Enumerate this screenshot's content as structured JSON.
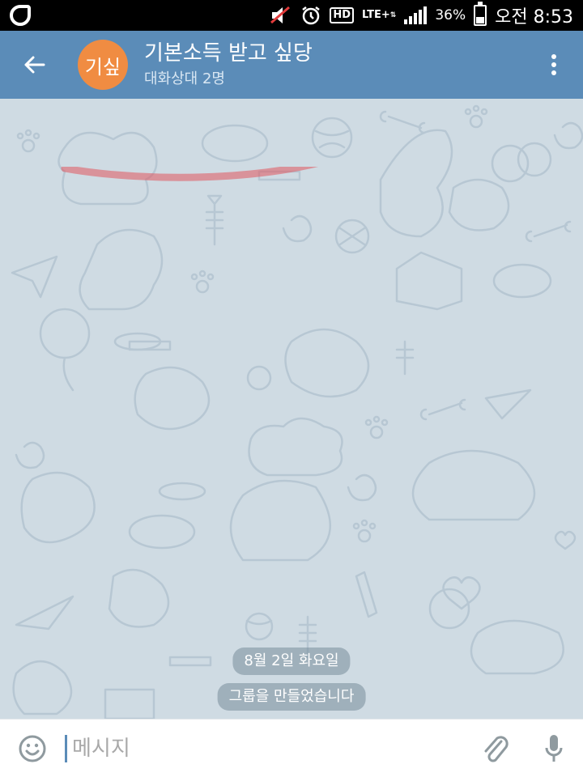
{
  "statusbar": {
    "hd": "HD",
    "lte": "LTE+",
    "battery_pct": "36%",
    "time": "오전 8:53",
    "icons": [
      "app-icon",
      "mute-icon",
      "alarm-icon",
      "hd-voice-icon",
      "lte-icon",
      "signal-icon",
      "battery-icon"
    ]
  },
  "header": {
    "avatar_text": "기싶",
    "avatar_color": "#f08c42",
    "title": "기본소득 받고 싶당",
    "subtitle": "대화상대 2명",
    "bar_color": "#5b8cb8"
  },
  "chat": {
    "date_label": "8월 2일 화요일",
    "service_message": "그룹을 만들었습니다"
  },
  "composer": {
    "placeholder": "메시지"
  }
}
